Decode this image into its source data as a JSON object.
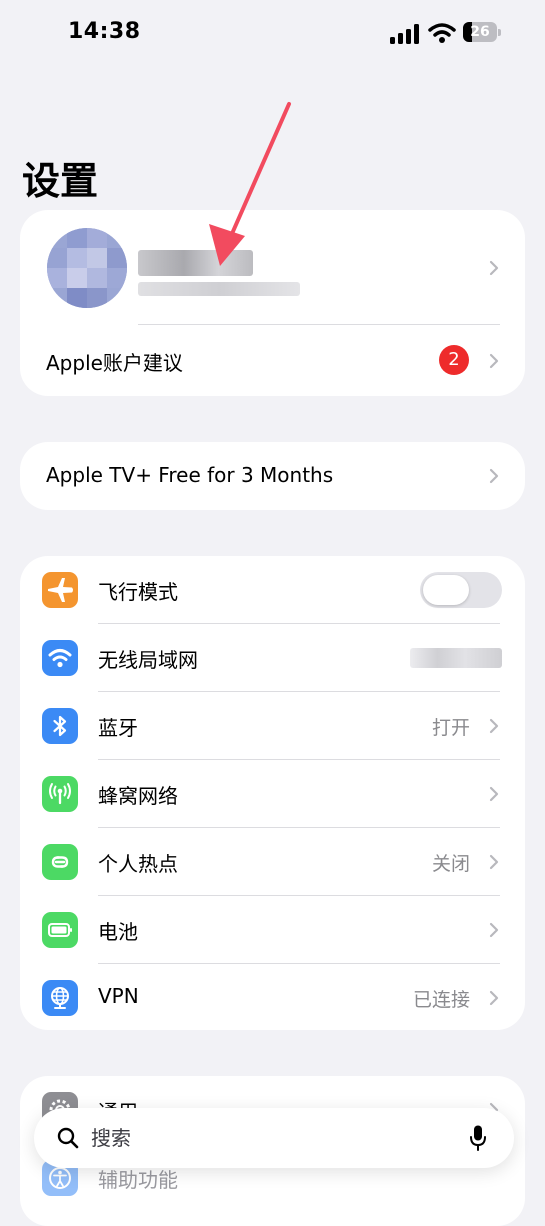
{
  "status_bar": {
    "time": "14:38",
    "battery": "26",
    "battery_level": 0.26
  },
  "page": {
    "title": "设置"
  },
  "account_card": {
    "suggestion_label": "Apple账户建议",
    "suggestion_badge": "2"
  },
  "promo_card": {
    "label": "Apple TV+ Free for 3 Months"
  },
  "connectivity": {
    "items": [
      {
        "label": "飞行模式",
        "icon": "airplane-icon",
        "color": "#f4952f",
        "toggle_on": false
      },
      {
        "label": "无线局域网",
        "icon": "wifi-icon",
        "color": "#3b8af5"
      },
      {
        "label": "蓝牙",
        "value": "打开",
        "icon": "bluetooth-icon",
        "color": "#3b8af5"
      },
      {
        "label": "蜂窝网络",
        "icon": "antenna-icon",
        "color": "#4cd964"
      },
      {
        "label": "个人热点",
        "value": "关闭",
        "icon": "hotspot-icon",
        "color": "#4cd964"
      },
      {
        "label": "电池",
        "icon": "battery-icon",
        "color": "#4cd964"
      },
      {
        "label": "VPN",
        "value": "已连接",
        "icon": "vpn-globe-icon",
        "color": "#3b8af5"
      }
    ]
  },
  "general_card": {
    "items": [
      {
        "label": "通用",
        "icon": "gear-icon",
        "color": "#8e8e93"
      },
      {
        "label": "辅助功能",
        "icon": "accessibility-icon",
        "color": "#3b8af5"
      }
    ]
  },
  "search": {
    "placeholder": "搜索"
  }
}
